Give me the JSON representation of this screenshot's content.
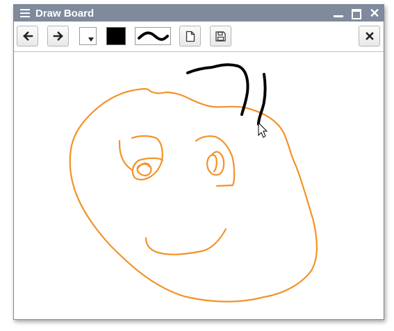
{
  "window": {
    "title": "Draw Board",
    "titlebar_icons": [
      "hamburger-menu-icon",
      "minimize-icon",
      "maximize-icon",
      "close-icon"
    ]
  },
  "toolbar": {
    "buttons": [
      "undo-arrow-left-icon",
      "redo-arrow-right-icon",
      "new-document-icon",
      "save-floppy-icon",
      "clear-x-icon"
    ],
    "selected_color": "#000000",
    "stroke_preview": "thick-wave"
  },
  "colors": {
    "titlebar": "#7f8b9c",
    "drawing_orange": "#f39227",
    "drawing_black": "#000000"
  }
}
